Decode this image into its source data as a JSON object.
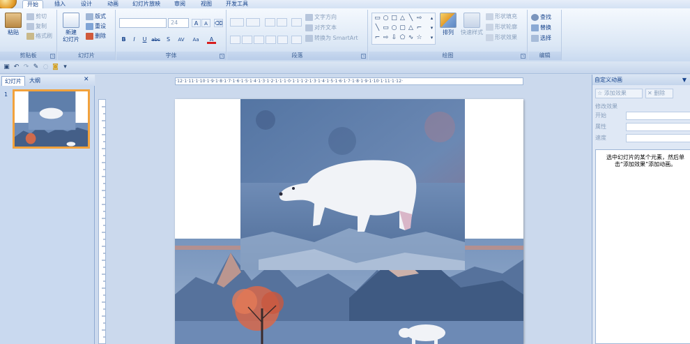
{
  "tabs": [
    "开始",
    "插入",
    "设计",
    "动画",
    "幻灯片放映",
    "审阅",
    "视图",
    "开发工具"
  ],
  "clipboard": {
    "paste": "粘贴",
    "cut": "剪切",
    "copy": "复制",
    "format_painter": "格式刷",
    "title": "剪贴板"
  },
  "slides_group": {
    "new_slide": "新建",
    "new_slide_2": "幻灯片",
    "layout": "版式",
    "reset": "重设",
    "delete": "删除",
    "title": "幻灯片"
  },
  "font_group": {
    "font_size": "24",
    "grow": "A",
    "shrink": "A",
    "bold": "B",
    "italic": "I",
    "underline": "U",
    "strike": "abc",
    "shadow": "S",
    "spacing": "AV",
    "case": "Aa",
    "color": "A",
    "title": "字体"
  },
  "paragraph_group": {
    "text_direction": "文字方向",
    "align_text": "对齐文本",
    "smartart": "转换为 SmartArt",
    "title": "段落"
  },
  "drawing_group": {
    "arrange": "排列",
    "quick_styles": "快速样式",
    "shape_fill": "形状填充",
    "shape_outline": "形状轮廓",
    "shape_effects": "形状效果",
    "title": "绘图"
  },
  "editing_group": {
    "find": "查找",
    "replace": "替换",
    "select": "选择",
    "title": "编辑"
  },
  "left_pane": {
    "tab_slides": "幻灯片",
    "tab_outline": "大纲",
    "close": "✕",
    "slide_number": "1"
  },
  "ruler": {
    "h_ticks": "·12·1·11·1·10·1·9·1·8·1·7·1·6·1·5·1·4·1·3·1·2·1·1·1·0·1·1·1·2·1·3·1·4·1·5·1·6·1·7·1·8·1·9·1·10·1·11·1·12·"
  },
  "right_pane": {
    "title": "自定义动画",
    "add_effect": "添加效果",
    "remove": "删除",
    "modify_effect": "修改效果",
    "start_label": "开始",
    "property_label": "属性",
    "speed_label": "速度",
    "hint": "选中幻灯片的某个元素，然后单击“添加效果”添加动画。"
  },
  "colors": {
    "ribbon_bg": "#dbe7f5",
    "accent": "#15428b",
    "thumb_border": "#f2a23c",
    "sky": "#5b7ba8",
    "bear": "#f0f2f6"
  },
  "icons": [
    "paste-icon",
    "cut-icon",
    "copy-icon",
    "format-painter-icon",
    "new-slide-icon",
    "layout-icon",
    "reset-icon",
    "delete-icon",
    "find-icon",
    "replace-icon",
    "select-icon",
    "save-icon",
    "undo-icon",
    "redo-icon"
  ]
}
